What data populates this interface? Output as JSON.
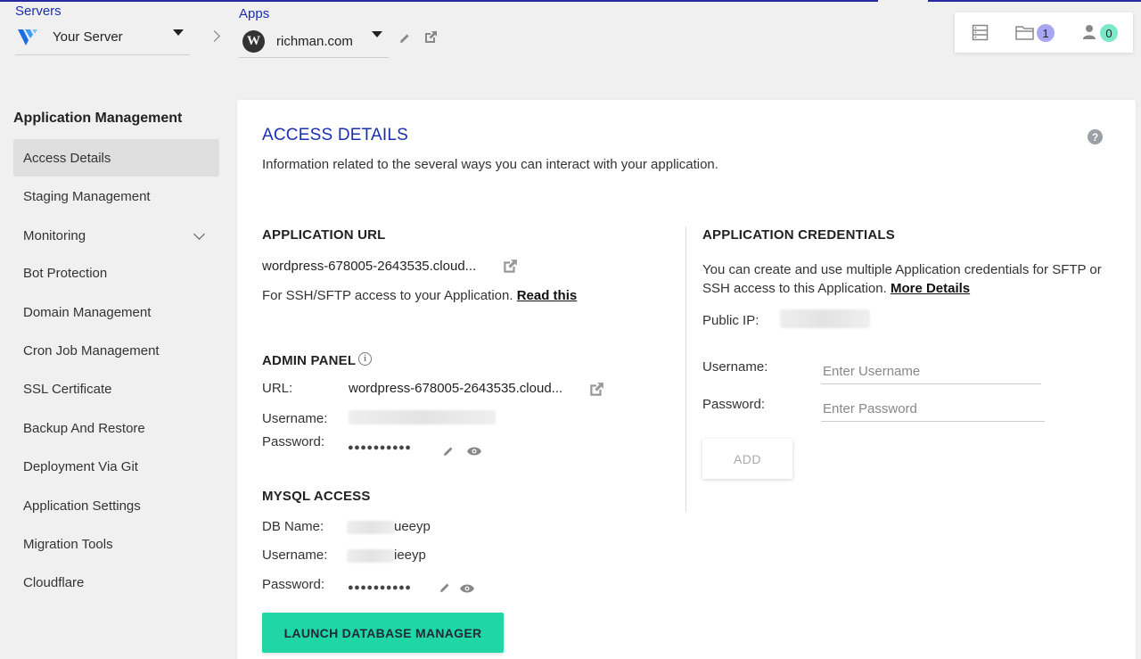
{
  "header": {
    "servers_label": "Servers",
    "server_name": "Your Server",
    "apps_label": "Apps",
    "app_name": "richman.com",
    "server_logo": "vultr-logo",
    "app_logo_text": "W",
    "notifications": {
      "apps_count": "1",
      "users_count": "0",
      "apps_badge_color": "#a9a6f0",
      "users_badge_color": "#7de8c8"
    }
  },
  "sidebar": {
    "title": "Application Management",
    "items": [
      {
        "label": "Access Details"
      },
      {
        "label": "Staging Management"
      },
      {
        "label": "Monitoring"
      },
      {
        "label": "Bot Protection"
      },
      {
        "label": "Domain Management"
      },
      {
        "label": "Cron Job Management"
      },
      {
        "label": "SSL Certificate"
      },
      {
        "label": "Backup And Restore"
      },
      {
        "label": "Deployment Via Git"
      },
      {
        "label": "Application Settings"
      },
      {
        "label": "Migration Tools"
      },
      {
        "label": "Cloudflare"
      }
    ]
  },
  "main": {
    "title": "ACCESS DETAILS",
    "subtitle": "Information related to the several ways you can interact with your application.",
    "help_icon": "?",
    "app_url": {
      "heading": "APPLICATION URL",
      "url": "wordpress-678005-2643535.cloud...",
      "ssh_text": "For SSH/SFTP access to your Application.",
      "ssh_link": "Read this"
    },
    "admin_panel": {
      "heading": "ADMIN PANEL",
      "url_label": "URL:",
      "url": "wordpress-678005-2643535.cloud...",
      "username_label": "Username:",
      "password_label": "Password:",
      "password_mask": "●●●●●●●●●●"
    },
    "mysql": {
      "heading": "MYSQL ACCESS",
      "db_label": "DB Name:",
      "db_suffix": "ueeyp",
      "username_label": "Username:",
      "username_suffix": "ieeyp",
      "password_label": "Password:",
      "password_mask": "●●●●●●●●●●",
      "launch_label": "LAUNCH DATABASE MANAGER"
    },
    "credentials": {
      "heading": "APPLICATION CREDENTIALS",
      "desc": "You can create and use multiple Application credentials for SFTP or SSH access to this Application.",
      "desc_link": "More Details",
      "public_ip_label": "Public IP:",
      "username_label": "Username:",
      "username_placeholder": "Enter Username",
      "password_label": "Password:",
      "password_placeholder": "Enter Password",
      "add_label": "ADD"
    }
  },
  "colors": {
    "accent": "#1a2fb0",
    "launch_button": "#1fd6a4",
    "active_sidebar": "#dedede"
  }
}
